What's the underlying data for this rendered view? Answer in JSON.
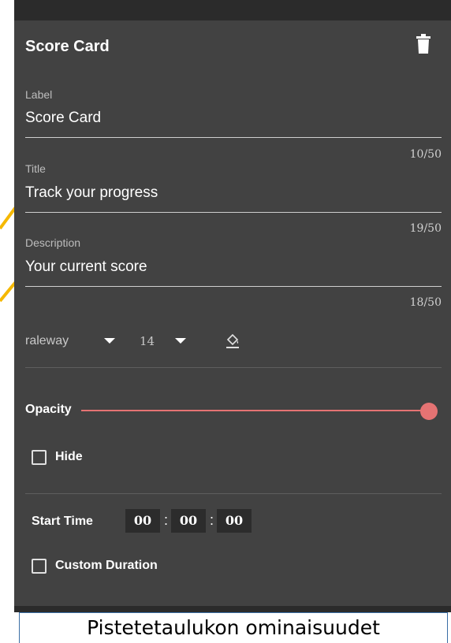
{
  "panel": {
    "title": "Score Card",
    "fields": [
      {
        "label": "Label",
        "value": "Score Card",
        "counter": "10/50"
      },
      {
        "label": "Title",
        "value": "Track your progress",
        "counter": "19/50"
      },
      {
        "label": "Description",
        "value": "Your current score",
        "counter": "18/50"
      }
    ],
    "font": {
      "family": "raleway",
      "size": "14"
    },
    "opacity": {
      "label": "Opacity",
      "value_fraction": 1.0
    },
    "hide": {
      "label": "Hide",
      "checked": false
    },
    "start_time": {
      "label": "Start Time",
      "hours": "00",
      "minutes": "00",
      "seconds": "00",
      "separator": ":"
    },
    "custom_duration": {
      "label": "Custom Duration",
      "checked": false
    }
  },
  "caption": "Pistetetaulukon ominaisuudet",
  "colors": {
    "panel_bg": "#424242",
    "accent": "#e57373",
    "connector": "#f5b800",
    "text": "#ffffff"
  },
  "icons": [
    "trash-icon",
    "paint-bucket-icon",
    "caret-down-icon"
  ]
}
